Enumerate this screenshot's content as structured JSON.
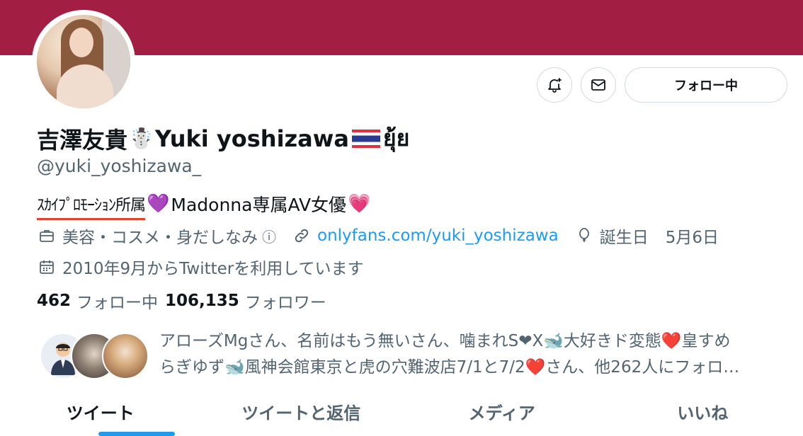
{
  "profile": {
    "name_jp": "吉澤友貴",
    "name_en": "Yuki yoshizawa",
    "name_thai": "ยุ้ย",
    "handle": "@yuki_yoshizawa_",
    "bio_agency": "ｽｶｲﾌﾟﾛﾓｰｼｮﾝ所属",
    "bio_rest": "Madonna専属AV女優",
    "category": "美容・コスメ・身だしなみ",
    "link": "onlyfans.com/yuki_yoshizawa",
    "birthday_label": "誕生日",
    "birthday": "5月6日",
    "joined": "2010年9月からTwitterを利用しています"
  },
  "actions": {
    "follow_label": "フォロー中"
  },
  "stats": {
    "following_count": "462",
    "following_label": "フォロー中",
    "followers_count": "106,135",
    "followers_label": "フォロワー"
  },
  "followed_by": {
    "line1": "アローズMgさん、名前はもう無いさん、噛まれS❤X🐋大好きド変態❤️皇すめ",
    "line2": "らぎゆず🐋風神会館東京と虎の穴難波店7/1と7/2❤️さん、他262人にフォロ…"
  },
  "tabs": [
    {
      "label": "ツイート",
      "active": true
    },
    {
      "label": "ツイートと返信",
      "active": false
    },
    {
      "label": "メディア",
      "active": false
    },
    {
      "label": "いいね",
      "active": false
    }
  ],
  "icons": {
    "snowman": "☃️",
    "flag": "thai-flag",
    "heart_purple": "💜",
    "heart_pink": "💗",
    "info": "ⓘ"
  },
  "colors": {
    "banner": "#a21f43",
    "link": "#1d9bf0",
    "muted": "#536471",
    "tab_indicator": "#1d9bf0"
  }
}
